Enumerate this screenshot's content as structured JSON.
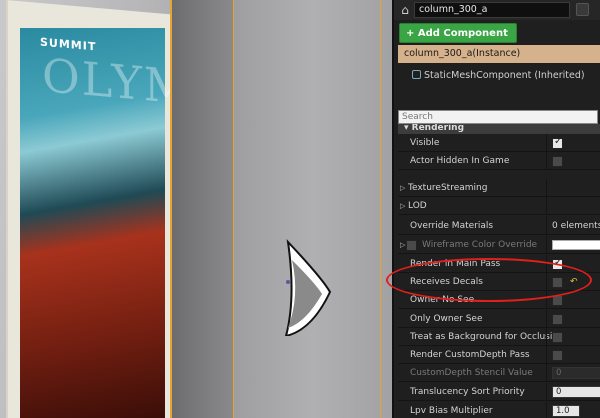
{
  "header": {
    "actor_name": "column_300_a",
    "add_component_label": "+ Add Component ▾"
  },
  "components": {
    "selected": "column_300_a(Instance)",
    "mesh": "StaticMeshComponent (Inherited)"
  },
  "search": {
    "placeholder": "Search"
  },
  "category": {
    "title": "▾ Rendering"
  },
  "poster": {
    "brand": "SUMMIT",
    "headline": "OLYMP"
  },
  "properties": [
    {
      "label": "Visible",
      "type": "checkbox",
      "checked": true
    },
    {
      "label": "Actor Hidden In Game",
      "type": "checkbox",
      "checked": false
    },
    {
      "label": "TextureStreaming",
      "type": "group"
    },
    {
      "label": "LOD",
      "type": "group"
    },
    {
      "label": "Override Materials",
      "type": "text",
      "value": "0 elements"
    },
    {
      "label": "Wireframe Color Override",
      "type": "color",
      "muted": true
    },
    {
      "label": "Render in Main Pass",
      "type": "checkbox",
      "checked": true
    },
    {
      "label": "Receives Decals",
      "type": "checkbox",
      "checked": false,
      "reset": "↶"
    },
    {
      "label": "Owner No See",
      "type": "checkbox",
      "checked": false
    },
    {
      "label": "Only Owner See",
      "type": "checkbox",
      "checked": false
    },
    {
      "label": "Treat as Background for Occlusion",
      "type": "checkbox",
      "checked": false
    },
    {
      "label": "Render CustomDepth Pass",
      "type": "checkbox",
      "checked": false
    },
    {
      "label": "CustomDepth Stencil Value",
      "type": "number",
      "value": "0",
      "muted": true
    },
    {
      "label": "Translucency Sort Priority",
      "type": "number",
      "value": "0",
      "light": true
    },
    {
      "label": "Lpv Bias Multiplier",
      "type": "number",
      "value": "1.0"
    }
  ],
  "colors": {
    "accent_green": "#3aa544",
    "selection": "#d6b28c",
    "highlight": "#e0201c",
    "selection_outline": "#e8a431"
  }
}
